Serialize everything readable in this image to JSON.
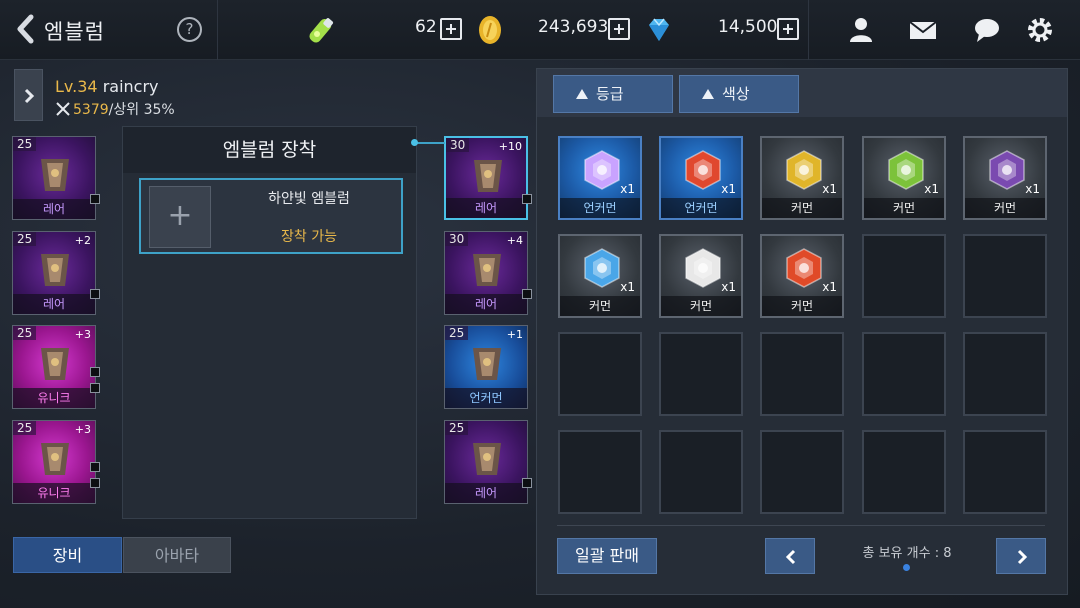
{
  "header": {
    "title": "엠블럼",
    "help": "?",
    "stamina": "62",
    "gold": "243,693",
    "gems": "14,500"
  },
  "character": {
    "level": "Lv.34",
    "name": "raincry",
    "power": "5379",
    "rank": "/상위 35%"
  },
  "left_equipment": [
    {
      "level": "25",
      "enh": "",
      "grade": "레어",
      "cls": "rare"
    },
    {
      "level": "25",
      "enh": "+2",
      "grade": "레어",
      "cls": "rare"
    },
    {
      "level": "25",
      "enh": "+3",
      "grade": "유니크",
      "cls": "unique"
    },
    {
      "level": "25",
      "enh": "+3",
      "grade": "유니크",
      "cls": "unique"
    }
  ],
  "right_equipment": [
    {
      "level": "30",
      "enh": "+10",
      "grade": "레어",
      "cls": "rare"
    },
    {
      "level": "30",
      "enh": "+4",
      "grade": "레어",
      "cls": "rare"
    },
    {
      "level": "25",
      "enh": "+1",
      "grade": "언커먼",
      "cls": "uncommon"
    },
    {
      "level": "25",
      "enh": "",
      "grade": "레어",
      "cls": "rare"
    }
  ],
  "emblem_panel": {
    "title": "엠블럼 장착",
    "slot_name": "하얀빛 엠블럼",
    "slot_status": "장착 가능",
    "plus": "+"
  },
  "bottom_tabs": {
    "equip": "장비",
    "avatar": "아바타"
  },
  "inventory": {
    "sort_grade": "등급",
    "sort_color": "색상",
    "items": [
      {
        "grade": "언커먼",
        "count": "x1",
        "color": "#c9a3ff",
        "cls": "unc"
      },
      {
        "grade": "언커먼",
        "count": "x1",
        "color": "#e0482e",
        "cls": "unc"
      },
      {
        "grade": "커먼",
        "count": "x1",
        "color": "#e0b52a",
        "cls": "com"
      },
      {
        "grade": "커먼",
        "count": "x1",
        "color": "#7cc23a",
        "cls": "com"
      },
      {
        "grade": "커먼",
        "count": "x1",
        "color": "#7a4ab0",
        "cls": "com"
      },
      {
        "grade": "커먼",
        "count": "x1",
        "color": "#4aa6e8",
        "cls": "com"
      },
      {
        "grade": "커먼",
        "count": "x1",
        "color": "#e8e8e8",
        "cls": "com"
      },
      {
        "grade": "커먼",
        "count": "x1",
        "color": "#e04a28",
        "cls": "com"
      }
    ],
    "sell_label": "일괄 판매",
    "count_label": "총 보유 개수 : 8"
  }
}
